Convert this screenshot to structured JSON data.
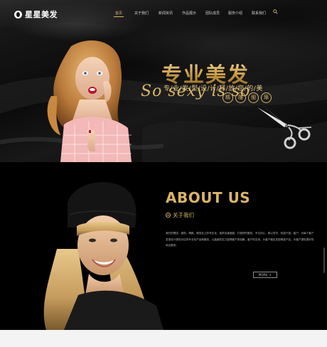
{
  "brand": {
    "logo_text": "星星美发"
  },
  "nav": {
    "items": [
      "首页",
      "关于我们",
      "新闻资讯",
      "作品展示",
      "团队成员",
      "服务介绍",
      "联系我们"
    ],
    "active_index": 0
  },
  "hero": {
    "title": "专业美发",
    "tagline": "专/业/发/型/设/计/释/放/您/的/美",
    "script": "So sexy is so",
    "badges": [
      "精",
      "雕",
      "细",
      "琢"
    ]
  },
  "about": {
    "title": "ABOUT US",
    "subtitle": "关于我们",
    "body": "我们的理念：超前、精致、服务至上的专业化，追求自身超越，打造好的服务。不忘初心，致以芳华，科技兴旅。客户，为每个客户发型设计提供对应的专业化产品和服务。以高超的实力赢得客户的信赖。客户的支持，为客户做出发型精选产品，为客户提供更好的综合服务。",
    "more_label": "MORE +"
  },
  "colors": {
    "accent": "#d9b46a",
    "hero_bg": "#0b0b0b",
    "about_bg": "#000000"
  }
}
